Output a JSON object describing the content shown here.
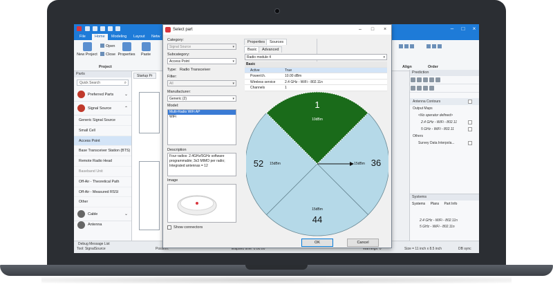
{
  "app": {
    "tabs": [
      "File",
      "Home",
      "Modeling",
      "Layout",
      "Netw"
    ],
    "active_tab": "Home",
    "ribbon": {
      "new_project": "New Project",
      "open": "Open",
      "close": "Close",
      "properties": "Properties",
      "paste": "Paste",
      "project_group": "Project",
      "align_group": "Align",
      "order_group": "Order"
    }
  },
  "parts_panel": {
    "title": "Parts",
    "search_placeholder": "Quick Search",
    "preferred_parts": "Preferred Parts",
    "signal_source": "Signal Source",
    "items": [
      "Generic Signal Source",
      "Small Cell",
      "Access Point",
      "Base Transceiver Station (BTS)",
      "Remote Radio Head",
      "Baseband Unit",
      "Off-Air - Theoretical Path",
      "Off-Air - Measured RSSI",
      "Other"
    ],
    "selected_item": "Access Point",
    "cable": "Cable",
    "antenna": "Antenna"
  },
  "canvas": {
    "doc_tab": "Startup Pr"
  },
  "prediction_panel": {
    "title": "Prediction",
    "rows": [
      "Antenna Contours",
      "Output Maps",
      "<No operator defined>",
      "2.4 GHz - WiFi - 802.11",
      "5 GHz - WiFi - 802.11",
      "Others",
      "Survey Data Interpola..."
    ]
  },
  "systems_panel": {
    "title": "Systems",
    "tabs": [
      "Systems",
      "Plans",
      "Part Info"
    ],
    "rows": [
      "2.4 GHz - WiFi - 802.11n",
      "5 GHz - WiFi - 802.11n"
    ]
  },
  "statusbar": {
    "debug": "Debug Message List",
    "tool": "Tool: SignalSource",
    "position": "Position:",
    "elapsed": "Elapsed time: 0:00:00",
    "warnings": "Warnings: 0",
    "size": "Size = 11 inch x 8.5 inch",
    "db": "DB sync"
  },
  "dialog": {
    "title": "Select part",
    "category_label": "Category:",
    "category_value": "Signal Source",
    "subcategory_label": "Subcategory:",
    "subcategory_value": "Access Point",
    "type_label": "Type:",
    "type_value": "Radio Transceiver",
    "filter_label": "Filter:",
    "filter_value": "All",
    "manufacturer_label": "Manufacturer:",
    "manufacturer_value": "Generic (2)",
    "model_label": "Model:",
    "models": [
      "Multi-Radio WiFi AP",
      "WiFi"
    ],
    "selected_model": "Multi-Radio WiFi AP",
    "description_label": "Description",
    "description": "Four radios: 2.4GHz/5GHz software programmable; 3x3 MIMO per radio; Integrated antennas = 12",
    "image_label": "Image",
    "show_connectors": "Show connectors",
    "ok": "OK",
    "cancel": "Cancel",
    "right_tabs": [
      "Properties",
      "Sources"
    ],
    "active_right_tab": "Sources",
    "sub_tabs": [
      "Basic",
      "Advanced"
    ],
    "active_sub_tab": "Basic",
    "source_combo": "Radio module 4",
    "prop_header": "Basic",
    "props": [
      {
        "key": "Active",
        "value": "True"
      },
      {
        "key": "Power/ch.",
        "value": "10.00 dBm"
      },
      {
        "key": "Wireless service",
        "value": "2.4 GHz - WiFi - 802.11n"
      },
      {
        "key": "Channels",
        "value": "1"
      }
    ]
  },
  "sector_diagram": {
    "sectors": [
      {
        "label": "1",
        "power": "10dBm",
        "color": "#1a6b1a"
      },
      {
        "label": "36",
        "power": "15dBm",
        "color": "#b5d9e8"
      },
      {
        "label": "44",
        "power": "15dBm",
        "color": "#b5d9e8"
      },
      {
        "label": "52",
        "power": "15dBm",
        "color": "#b5d9e8"
      }
    ]
  },
  "colors": {
    "accent": "#1e7bd8",
    "selected": "#d3e4f7",
    "sector_active": "#1a6b1a",
    "sector_other": "#b5d9e8"
  }
}
